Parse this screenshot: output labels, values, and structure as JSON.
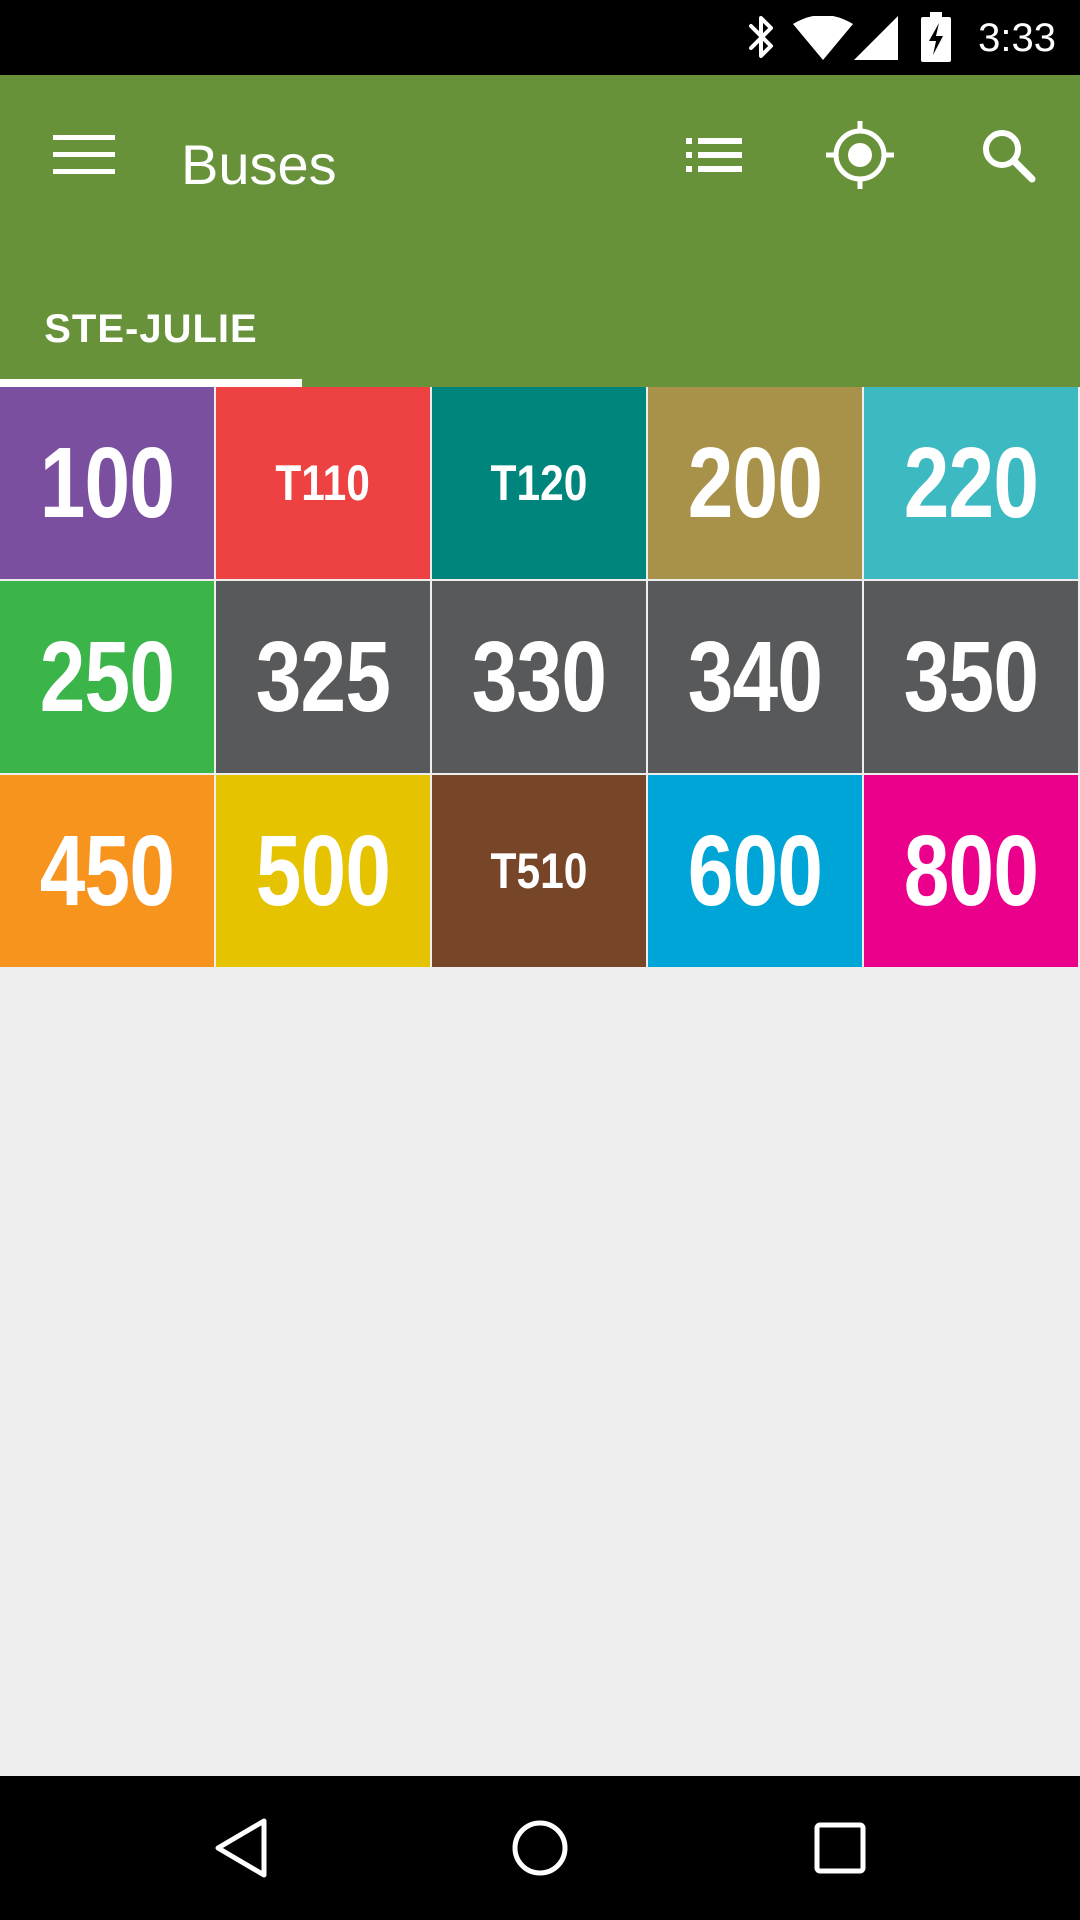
{
  "status_bar": {
    "time": "3:33",
    "icons": [
      "bluetooth-icon",
      "wifi-icon",
      "signal-icon",
      "battery-charging-icon"
    ]
  },
  "app_bar": {
    "title": "Buses",
    "background": "#67923a",
    "actions": [
      "menu-icon",
      "list-icon",
      "location-icon",
      "search-icon"
    ]
  },
  "tabs": [
    {
      "label": "STE-JULIE",
      "selected": true
    }
  ],
  "routes": [
    {
      "label": "100",
      "color": "#7b4fa0"
    },
    {
      "label": "T110",
      "color": "#ee4142"
    },
    {
      "label": "T120",
      "color": "#00857d"
    },
    {
      "label": "200",
      "color": "#a89249"
    },
    {
      "label": "220",
      "color": "#3cb9c1"
    },
    {
      "label": "250",
      "color": "#3bb44a"
    },
    {
      "label": "325",
      "color": "#58595b"
    },
    {
      "label": "330",
      "color": "#58595b"
    },
    {
      "label": "340",
      "color": "#58595b"
    },
    {
      "label": "350",
      "color": "#58595b"
    },
    {
      "label": "450",
      "color": "#f7941e"
    },
    {
      "label": "500",
      "color": "#e5c300"
    },
    {
      "label": "T510",
      "color": "#774527"
    },
    {
      "label": "600",
      "color": "#00a5d7"
    },
    {
      "label": "800",
      "color": "#eb008b"
    }
  ],
  "nav_bar": {
    "buttons": [
      "back-icon",
      "home-icon",
      "recents-icon"
    ]
  }
}
